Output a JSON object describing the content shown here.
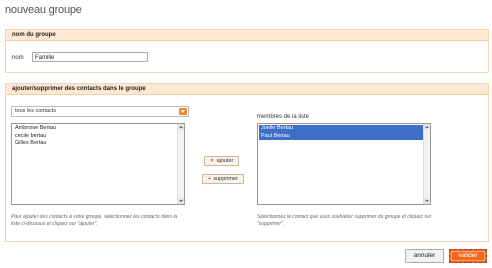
{
  "page": {
    "title": "nouveau groupe"
  },
  "name_section": {
    "heading": "nom du groupe",
    "field_label": "nom",
    "field_value": "Famille"
  },
  "members_section": {
    "heading": "ajouter/supprimer des contacts dans le groupe",
    "filter_select": {
      "selected": "tous les contacts"
    },
    "contacts": [
      "Ambroise Bertau",
      "cecile bertau",
      "Gilles Bertau"
    ],
    "members_title": "membres de la liste",
    "members": [
      {
        "name": "Joelle Bertau",
        "selected": true
      },
      {
        "name": "Paul Bertau",
        "selected": true
      }
    ],
    "add_label": "ajouter",
    "remove_label": "supprimer",
    "help_left": "Pour ajouter des contacts à votre groupe, sélectionnez les contacts dans la liste ci-dessous et cliquez sur \"ajouter\".",
    "help_right": "Sélectionnez le contact que vous souhaitez supprimer du groupe et cliquez sur \"supprimer\"."
  },
  "actions": {
    "cancel_label": "annuler",
    "ok_label": "valider"
  },
  "colors": {
    "accent": "#ef6a1c",
    "panel_header": "#fde8d2",
    "selection": "#3d6fc8"
  }
}
